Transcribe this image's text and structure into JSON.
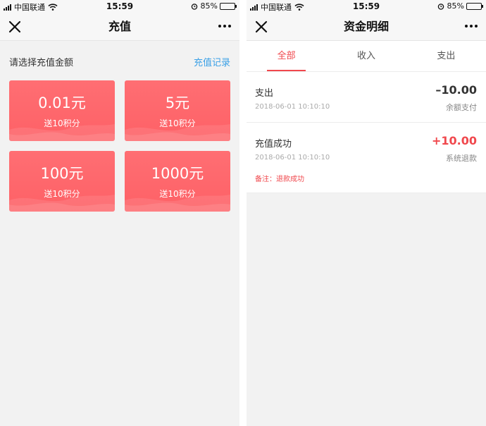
{
  "left_screen": {
    "status_bar": {
      "carrier": "中国联通",
      "time": "15:59",
      "battery": "85%",
      "battery_level": 0.85
    },
    "nav": {
      "title": "充值"
    },
    "header": {
      "label": "请选择充值金额",
      "link": "充值记录"
    },
    "options": [
      {
        "amount": "0.01元",
        "bonus": "送10积分"
      },
      {
        "amount": "5元",
        "bonus": "送10积分"
      },
      {
        "amount": "100元",
        "bonus": "送10积分"
      },
      {
        "amount": "1000元",
        "bonus": "送10积分"
      }
    ]
  },
  "right_screen": {
    "status_bar": {
      "carrier": "中国联通",
      "time": "15:59",
      "battery": "85%",
      "battery_level": 0.85
    },
    "nav": {
      "title": "资金明细"
    },
    "tabs": [
      {
        "label": "全部",
        "active": true
      },
      {
        "label": "收入",
        "active": false
      },
      {
        "label": "支出",
        "active": false
      }
    ],
    "transactions": [
      {
        "title": "支出",
        "date": "2018-06-01 10:10:10",
        "amount": "–10.00",
        "method": "余额支付"
      },
      {
        "title": "充值成功",
        "date": "2018-06-01 10:10:10",
        "amount": "+10.00",
        "method": "系统退款",
        "note": "备注：退款成功"
      }
    ]
  },
  "colors": {
    "accent": "#f0484d",
    "card": "#fd6166",
    "link": "#3aa0e6"
  }
}
